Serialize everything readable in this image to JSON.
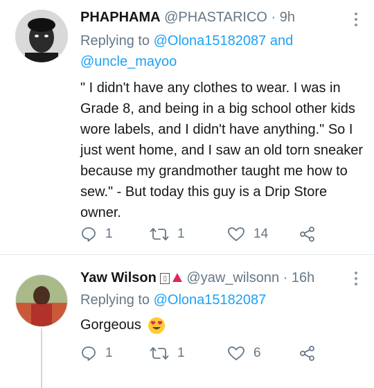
{
  "tweets": [
    {
      "display_name": "PHAPHAMA",
      "handle": "@PHASTARICO",
      "separator": "·",
      "time": "9h",
      "replying_prefix": "Replying to",
      "reply_to_1": "@Olona15182087",
      "reply_joiner": "and",
      "reply_to_2": "@uncle_mayoo",
      "text": "\" I didn't have any clothes to wear. I was in Grade 8, and being in a big school other kids wore labels, and I didn't have anything.\" So I just went home, and I saw an old torn sneaker because my grandmother taught me how to sew.\" - But today this guy is a Drip Store owner.",
      "reply_count": "1",
      "retweet_count": "1",
      "like_count": "14"
    },
    {
      "display_name": "Yaw Wilson",
      "name_badge_glyph": "▯",
      "handle": "@yaw_wilsonn",
      "separator": "·",
      "time": "16h",
      "replying_prefix": "Replying to",
      "reply_to_1": "@Olona15182087",
      "text": "Gorgeous",
      "text_emoji": "heart-eyes-emoji",
      "reply_count": "1",
      "retweet_count": "1",
      "like_count": "6"
    }
  ],
  "colors": {
    "link": "#1da1f2",
    "muted": "#657786",
    "text": "#14171a",
    "divider": "#e1e8ed",
    "flag_red": "#e0245e"
  },
  "icons": [
    "reply-icon",
    "retweet-icon",
    "like-icon",
    "share-icon",
    "more-icon"
  ]
}
